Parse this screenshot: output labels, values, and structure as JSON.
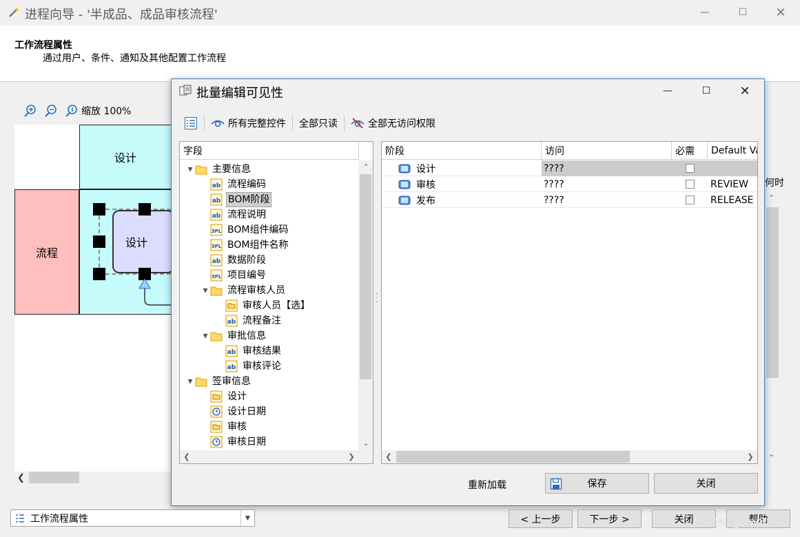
{
  "window": {
    "title": "进程向导 - '半成品、成品审核流程'"
  },
  "header": {
    "title": "工作流程属性",
    "subtitle": "通过用户、条件、通知及其他配置工作流程"
  },
  "zoom": {
    "label": "缩放 100%"
  },
  "diagram": {
    "lane_label": "流程",
    "phase_label": "设计",
    "node_label": "设计",
    "colors": {
      "lane": "#ffbfbf",
      "phase": "#c6fbfb",
      "node": "#dcdcff"
    }
  },
  "right_edge_text": "何时",
  "dialog": {
    "title": "批量编辑可见性",
    "toolbar": {
      "all_full_controls": "所有完整控件",
      "all_readonly": "全部只读",
      "all_no_access": "全部无访问权限"
    },
    "field_tree": {
      "header": "字段",
      "rows": [
        {
          "label": "主要信息",
          "icon": "folder-icon",
          "expander": "▲"
        },
        {
          "label": "流程编码",
          "icon": "text-field-icon"
        },
        {
          "label": "BOM阶段",
          "icon": "text-field-icon",
          "selected": true
        },
        {
          "label": "流程说明",
          "icon": "text-field-icon"
        },
        {
          "label": "BOM组件编码",
          "icon": "lookup-field-icon"
        },
        {
          "label": "BOM组件名称",
          "icon": "lookup-field-icon"
        },
        {
          "label": "数据阶段",
          "icon": "text-field-icon"
        },
        {
          "label": "项目编号",
          "icon": "lookup-field-icon"
        },
        {
          "label": "流程审核人员",
          "icon": "folder-icon",
          "expander": "▲"
        },
        {
          "label": "审核人员【选】",
          "icon": "user-field-icon"
        },
        {
          "label": "流程备注",
          "icon": "text-field-icon"
        },
        {
          "label": "审批信息",
          "icon": "folder-icon",
          "expander": "▲"
        },
        {
          "label": "审核结果",
          "icon": "text-field-icon"
        },
        {
          "label": "审核评论",
          "icon": "text-field-icon"
        },
        {
          "label": "签审信息",
          "icon": "folder-icon",
          "expander": "▲"
        },
        {
          "label": "设计",
          "icon": "user-field-icon"
        },
        {
          "label": "设计日期",
          "icon": "clock-icon"
        },
        {
          "label": "审核",
          "icon": "user-field-icon"
        },
        {
          "label": "审核日期",
          "icon": "clock-icon"
        }
      ]
    },
    "stage_grid": {
      "headers": {
        "stage": "阶段",
        "access": "访问",
        "required": "必需",
        "default_value": "Default Va"
      },
      "rows": [
        {
          "stage": "设计",
          "access": "????",
          "required": false,
          "default_value": ""
        },
        {
          "stage": "审核",
          "access": "????",
          "required": false,
          "default_value": "REVIEW"
        },
        {
          "stage": "发布",
          "access": "????",
          "required": false,
          "default_value": "RELEASE"
        }
      ]
    },
    "buttons": {
      "reload": "重新加载",
      "save": "保存",
      "close": "关闭"
    }
  },
  "footer": {
    "dropdown_value": "工作流程属性",
    "prev": "< 上一步",
    "next": "下一步 >",
    "close": "关闭",
    "help": "帮助"
  },
  "watermark": "CSDN @xw887"
}
